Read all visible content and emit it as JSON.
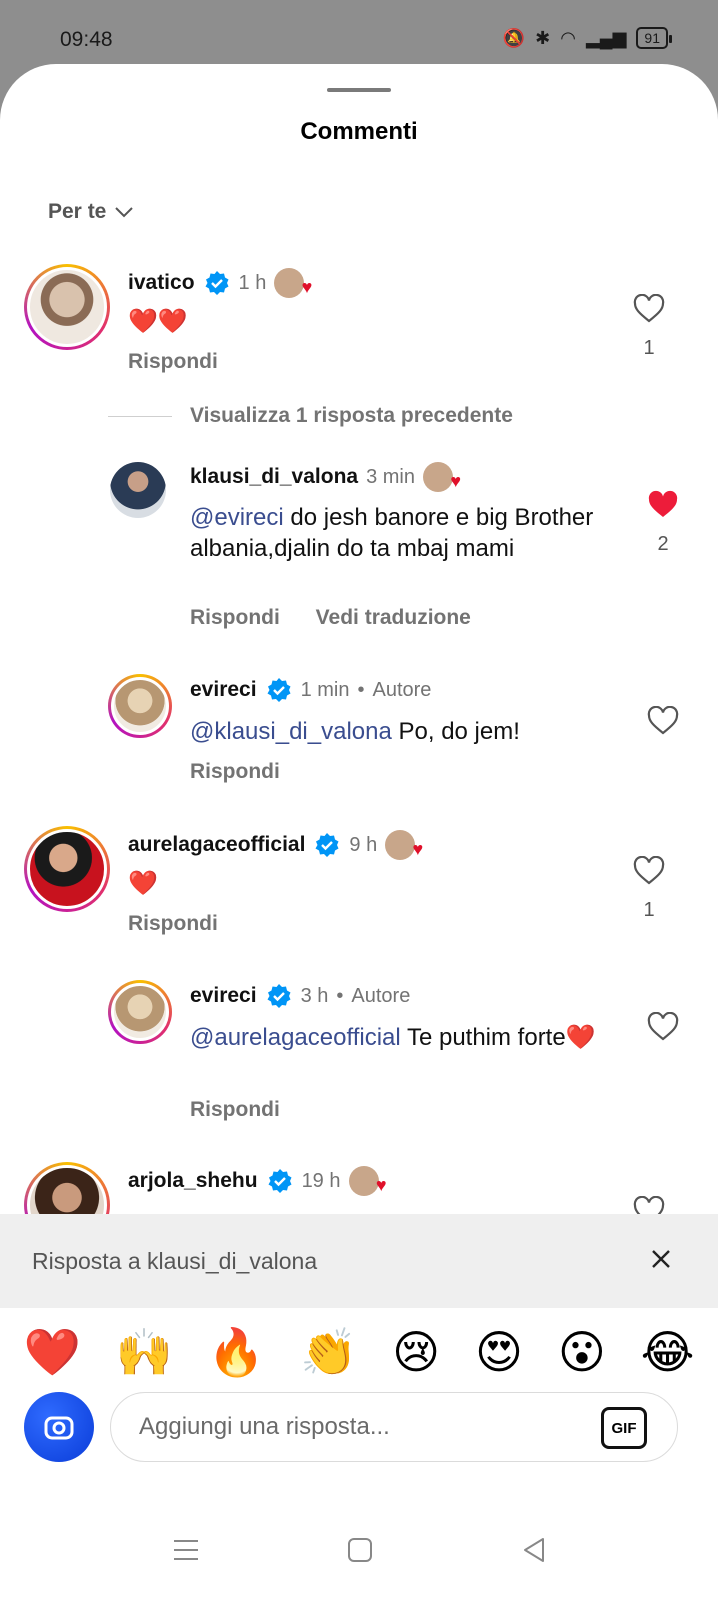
{
  "status": {
    "time": "09:48",
    "battery": "91"
  },
  "sheet": {
    "title": "Commenti",
    "sort_label": "Per te"
  },
  "comments": [
    {
      "username": "ivatico",
      "time": "1 h",
      "text": "❤️❤️",
      "reply": "Rispondi",
      "likes": "1",
      "liked": false
    },
    {
      "username": "aurelagaceofficial",
      "time": "9 h",
      "text": "❤️",
      "reply": "Rispondi",
      "likes": "1",
      "liked": false
    },
    {
      "username": "arjola_shehu",
      "time": "19 h"
    }
  ],
  "view_previous": "Visualizza 1 risposta precedente",
  "replies": [
    {
      "username": "klausi_di_valona",
      "time": "3 min",
      "mention": "@evireci",
      "text": " do jesh banore e big Brother albania,djalin do ta mbaj mami",
      "reply": "Rispondi",
      "translate": "Vedi traduzione",
      "likes": "2",
      "liked": true
    },
    {
      "username": "evireci",
      "time": "1 min",
      "author": "Autore",
      "mention": "@klausi_di_valona",
      "text": " Po, do jem!",
      "reply": "Rispondi",
      "liked": false
    },
    {
      "username": "evireci",
      "time": "3 h",
      "author": "Autore",
      "mention": "@aurelagaceofficial",
      "text": " Te puthim forte❤️",
      "reply": "Rispondi",
      "liked": false
    }
  ],
  "reply_bar": {
    "label": "Risposta a klausi_di_valona"
  },
  "emojis": [
    "❤️",
    "🙌",
    "🔥",
    "👏",
    "😢",
    "😍",
    "😮",
    "😂"
  ],
  "composer": {
    "placeholder": "Aggiungi una risposta...",
    "gif_label": "GIF"
  },
  "colors": {
    "like_red": "#ed1c3a",
    "mention": "#3a4d8f",
    "verified": "#0095f6"
  }
}
